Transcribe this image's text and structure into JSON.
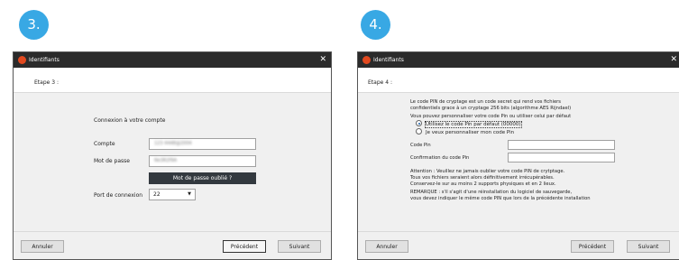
{
  "steps": [
    {
      "badge": "3.",
      "window_title": "Identifiants",
      "step_label": "Etape 3 :",
      "section_title": "Connexion à votre compte",
      "fields": {
        "account_label": "Compte",
        "account_value": "123 4448@2004",
        "password_label": "Mot de passe",
        "password_value": "Ne3R2f9A"
      },
      "forgot_password_button": "Mot de passe oublié ?",
      "port_label": "Port de connexion",
      "port_value": "22",
      "buttons": {
        "cancel": "Annuler",
        "previous": "Précédent",
        "next": "Suivant"
      }
    },
    {
      "badge": "4.",
      "window_title": "Identifiants",
      "step_label": "Etape 4 :",
      "intro_lines": [
        "Le code PIN de cryptage est un code secret qui rend vos fichiers",
        "confidentiels grace à un cryptage 256 bits (algorithme AES Rijndael)"
      ],
      "custom_prompt": "Vous pouvez personnaliser votre code Pin ou utiliser celui par défaut",
      "radio_options": [
        {
          "label": "Utilisez le code Pin par défaut (00000)",
          "selected": true
        },
        {
          "label": "Je veux personnaliser mon code Pin",
          "selected": false
        }
      ],
      "pin_label": "Code Pin",
      "pin_confirm_label": "Confirmation du code Pin",
      "warning_lines": [
        "Attention : Veuillez ne jamais oublier votre code PIN de crytptage.",
        "Tous vos fichiers seraient alors définitivement irrécupérables.",
        "Conservez-le sur au moins 2 supports physiques et en 2 lieux."
      ],
      "remark_lines": [
        "REMARQUE : s'il s'agit d'une réinstallation du logiciel de sauvegarde,",
        "vous devez indiquer le même code PIN que lors de la précédente installation"
      ],
      "buttons": {
        "cancel": "Annuler",
        "previous": "Précédent",
        "next": "Suivant"
      }
    }
  ],
  "colors": {
    "badge": "#38a8e4",
    "titlebar": "#2b2b2b",
    "app_icon": "#e2491f",
    "dark_button": "#33393f"
  },
  "icons": {
    "app": "app-logo-icon",
    "close": "close-icon",
    "dropdown": "chevron-down-icon"
  }
}
